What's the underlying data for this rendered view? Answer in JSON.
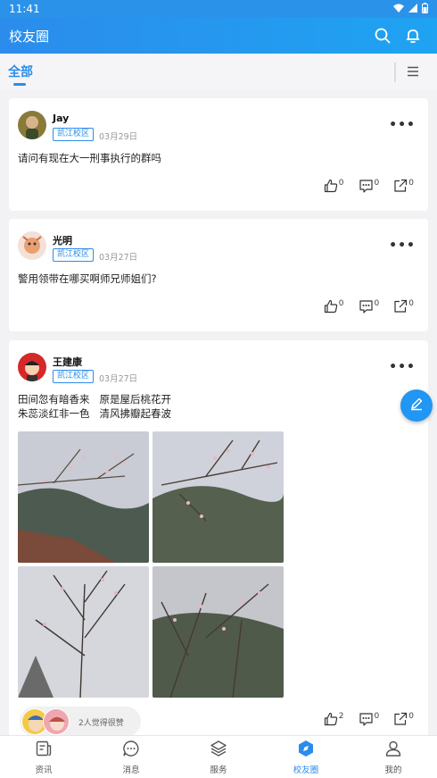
{
  "status_bar": {
    "time": "11:41"
  },
  "header": {
    "title": "校友圈",
    "icons": [
      "search-icon",
      "bell-icon"
    ]
  },
  "tabs": {
    "active": "全部",
    "menu_icon": "menu-icon"
  },
  "posts": [
    {
      "author": "Jay",
      "campus": "凯江校区",
      "date": "03月29日",
      "text": "请问有现在大一刑事执行的群吗",
      "likes": "0",
      "comments": "0",
      "shares": "0"
    },
    {
      "author": "光明",
      "campus": "凯江校区",
      "date": "03月27日",
      "text": "警用领带在哪买啊师兄师姐们?",
      "likes": "0",
      "comments": "0",
      "shares": "0"
    },
    {
      "author": "王建康",
      "campus": "凯江校区",
      "date": "03月27日",
      "text_line1": "田间忽有暗香来   原是屋后桃花开",
      "text_line2": "朱蕊淡红非一色   清风拂瓣起春波",
      "likes_summary": "2人觉得很赞",
      "likes": "2",
      "comments": "0",
      "shares": "0"
    }
  ],
  "fab": {
    "icon": "edit-icon"
  },
  "bottom_nav": [
    {
      "label": "资讯",
      "icon": "news-icon"
    },
    {
      "label": "消息",
      "icon": "message-icon"
    },
    {
      "label": "服务",
      "icon": "layers-icon"
    },
    {
      "label": "校友圈",
      "icon": "compass-icon",
      "active": true
    },
    {
      "label": "我的",
      "icon": "user-icon"
    }
  ],
  "colors": {
    "primary": "#2b8ceb",
    "background": "#f2f2f4"
  }
}
